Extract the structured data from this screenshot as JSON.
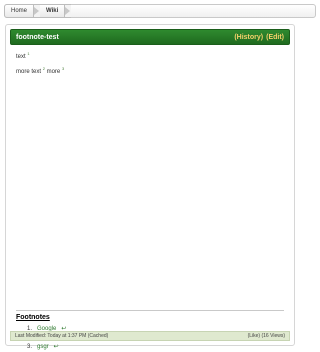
{
  "breadcrumb": {
    "items": [
      "Home",
      "Wiki"
    ]
  },
  "page": {
    "title": "footnote-test",
    "actions": [
      "(History)",
      "(Edit)"
    ],
    "content": {
      "line1_text": "text",
      "line1_sup": "1",
      "line2_part1": "more text",
      "line2_sup1": "2",
      "line2_part2": "more",
      "line2_sup2": "3"
    }
  },
  "footnotes": {
    "heading": "Footnotes",
    "items": [
      {
        "number": "1.",
        "label": "Google",
        "back": "↩"
      },
      {
        "number": "2.",
        "label": "wiki",
        "back": "↩"
      },
      {
        "number": "3.",
        "label": "gsgr",
        "back": "↩"
      }
    ]
  },
  "status": {
    "left": "Last Modified: Today at 1:37 PM (Cached)",
    "right": "(Like) (16 Views)"
  },
  "colors": {
    "header_green": "#1f6a1f",
    "header_action": "#f6d26b",
    "status_bg": "#dfe9cf",
    "link_green": "#2f7a2f"
  }
}
